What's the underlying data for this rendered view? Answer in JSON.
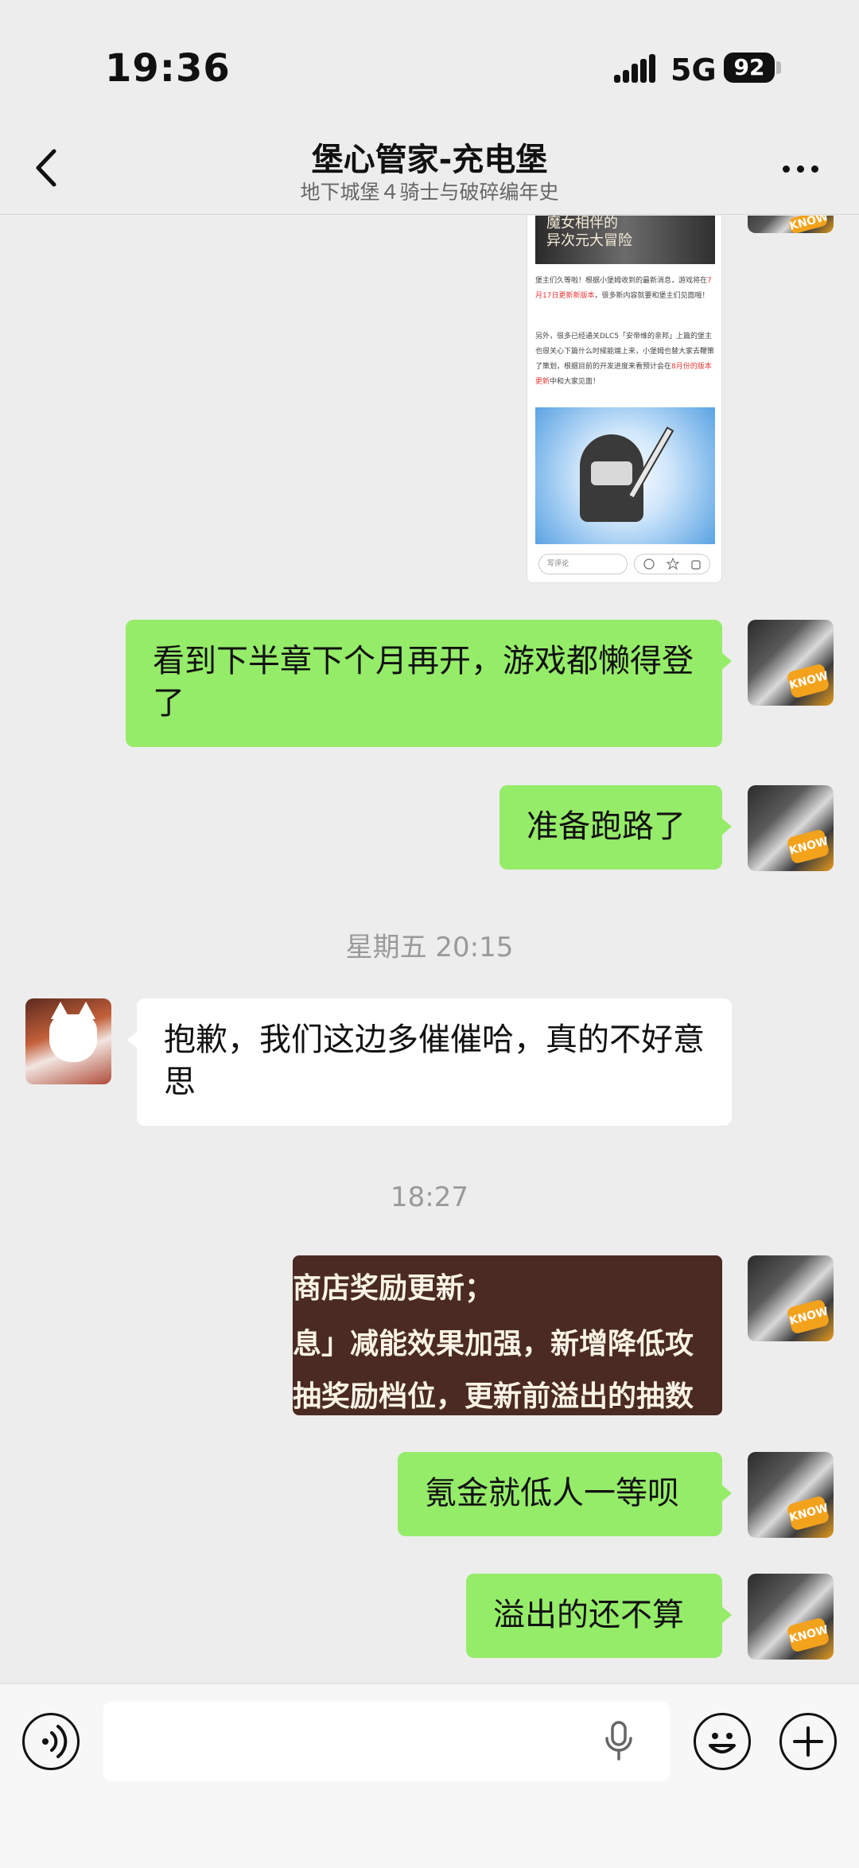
{
  "status_bar": {
    "time": "19:36",
    "network": "5G",
    "battery": "92"
  },
  "nav": {
    "title": "堡心管家-充电堡",
    "subtitle": "地下城堡４骑士与破碎编年史"
  },
  "article_image": {
    "banner_line1": "魔女相伴的",
    "banner_line2": "异次元大冒险",
    "para1_before": "堡主们久等啦！根据小堡姆收到的最新消息，游戏将在",
    "para1_red": "7月17日更新新版本",
    "para1_after": "，很多新内容就要和堡主们见面哦！",
    "para2_before": "另外，很多已经通关DLC5「安帝维的亲邦」上篇的堡主也很关心下篇什么时候能端上来，小堡姆也替大家去鞭策了策划，根据目前的开发进度来看预计会在",
    "para2_red": "8月份的版本更新",
    "para2_after": "中和大家见面！",
    "comment_placeholder": "写评论"
  },
  "game_image": {
    "line1": "商店奖励更新；",
    "line2": "息」减能效果加强，新增降低攻",
    "line3": "抽奖励档位，更新前溢出的抽数"
  },
  "messages": [
    {
      "sender": "me",
      "text": "看到下半章下个月再开，游戏都懒得登了"
    },
    {
      "sender": "me",
      "text": "准备跑路了"
    },
    {
      "sender": "other",
      "text": "抱歉，我们这边多催催哈，真的不好意思"
    },
    {
      "sender": "me",
      "text": "氪金就低人一等呗"
    },
    {
      "sender": "me",
      "text": "溢出的还不算"
    }
  ],
  "timestamps": [
    "星期五 20:15",
    "18:27"
  ],
  "icons": {
    "back": "back-chevron-icon",
    "more": "more-dots-icon",
    "voice": "voice-input-icon",
    "mic": "microphone-icon",
    "emoji": "emoji-icon",
    "plus": "plus-icon"
  }
}
